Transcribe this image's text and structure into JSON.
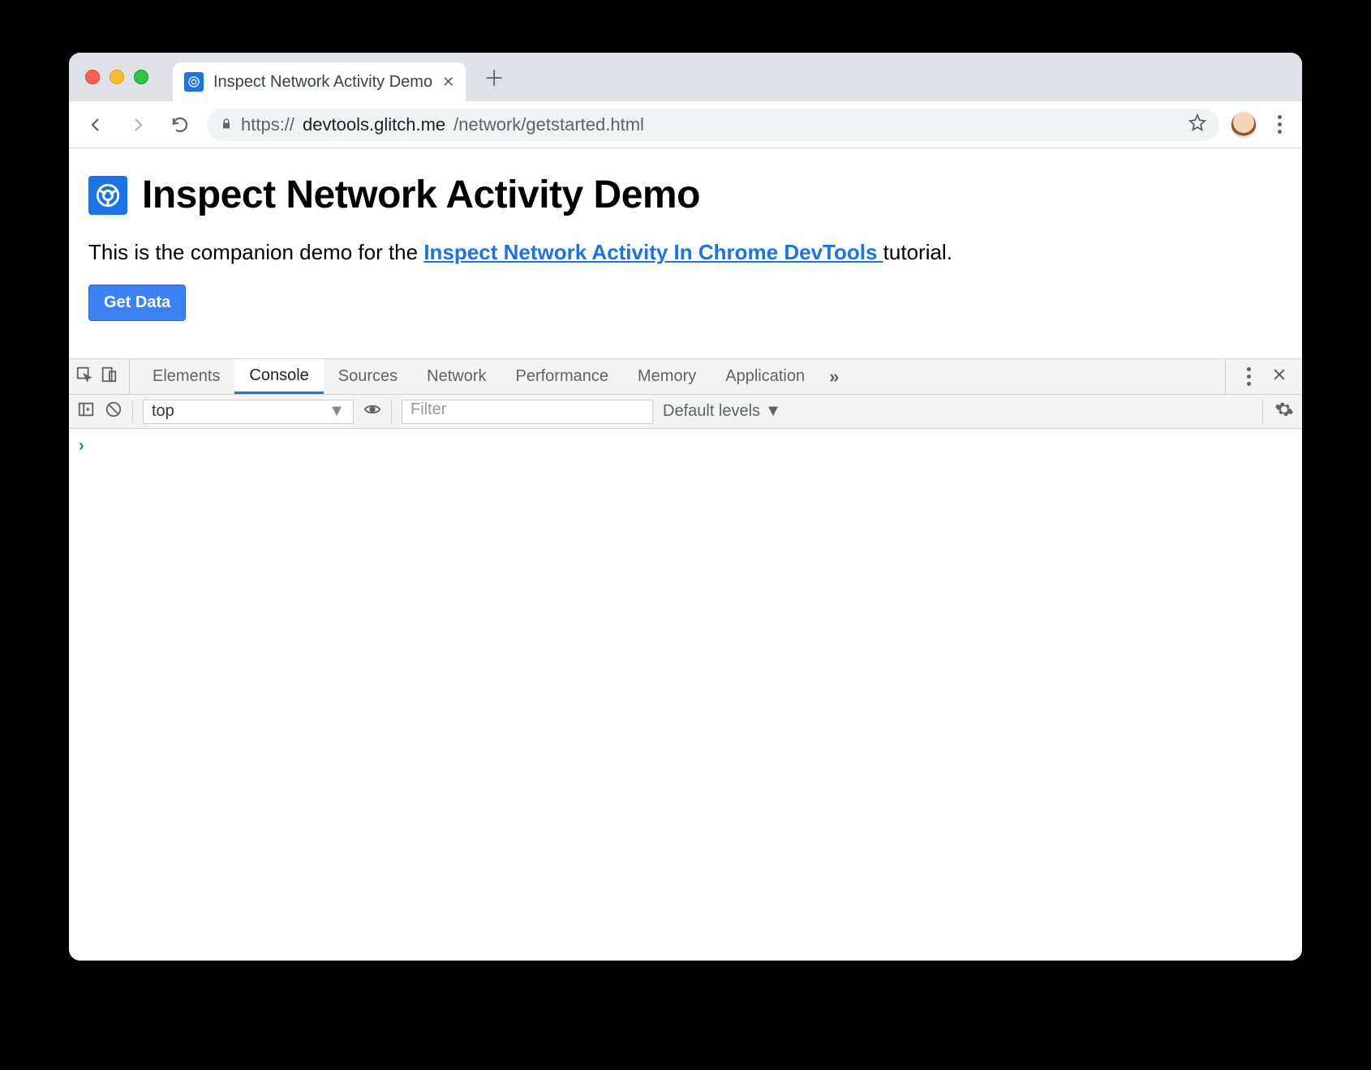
{
  "tab": {
    "title": "Inspect Network Activity Demo"
  },
  "url": {
    "scheme": "https://",
    "host": "devtools.glitch.me",
    "path": "/network/getstarted.html"
  },
  "page": {
    "heading": "Inspect Network Activity Demo",
    "intro_before": "This is the companion demo for the ",
    "link_text": "Inspect Network Activity In Chrome DevTools ",
    "intro_after": "tutorial.",
    "button_label": "Get Data"
  },
  "devtools": {
    "tabs": [
      "Elements",
      "Console",
      "Sources",
      "Network",
      "Performance",
      "Memory",
      "Application"
    ],
    "active_tab": "Console",
    "overflow": "»",
    "console": {
      "context": "top",
      "filter_placeholder": "Filter",
      "levels_label": "Default levels",
      "prompt": "›"
    }
  }
}
